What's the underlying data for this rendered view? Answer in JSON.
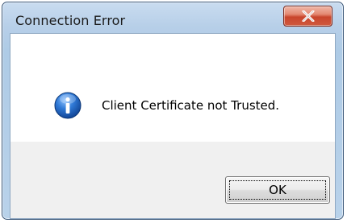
{
  "window": {
    "title": "Connection Error"
  },
  "titlebar": {
    "close_icon": "close-x-icon"
  },
  "message": {
    "icon": "info-icon",
    "text": "Client Certificate not Trusted."
  },
  "buttons": {
    "ok_label": "OK"
  },
  "colors": {
    "titlebar": "#b9d2ea",
    "close_button": "#c9452c",
    "message_background": "#ffffff",
    "button_area": "#f0f0f0",
    "info_icon": "#1f5fb8"
  }
}
